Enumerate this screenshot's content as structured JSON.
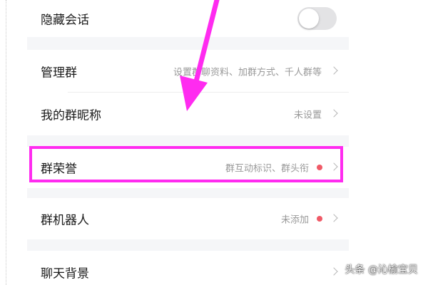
{
  "rows": [
    {
      "label": "隐藏会话",
      "toggle_on": false
    },
    {
      "label": "管理群",
      "value": "设置群聊资料、加群方式、千人群等"
    },
    {
      "label": "我的群昵称",
      "value": "未设置"
    },
    {
      "label": "群荣誉",
      "value": "群互动标识、群头衔",
      "badge": true
    },
    {
      "label": "群机器人",
      "value": "未添加",
      "badge": true
    },
    {
      "label": "聊天背景"
    }
  ],
  "watermark": "头条 @沁榆宝贝",
  "colors": {
    "background": "#f5f6f8",
    "row_background": "#ffffff",
    "highlight": "#ff2bf0",
    "badge_dot": "#f05a67",
    "secondary_text": "#999999"
  },
  "annotations": {
    "highlighted_row": "群荣誉",
    "arrow_icon": "magenta-arrow-down-icon"
  }
}
